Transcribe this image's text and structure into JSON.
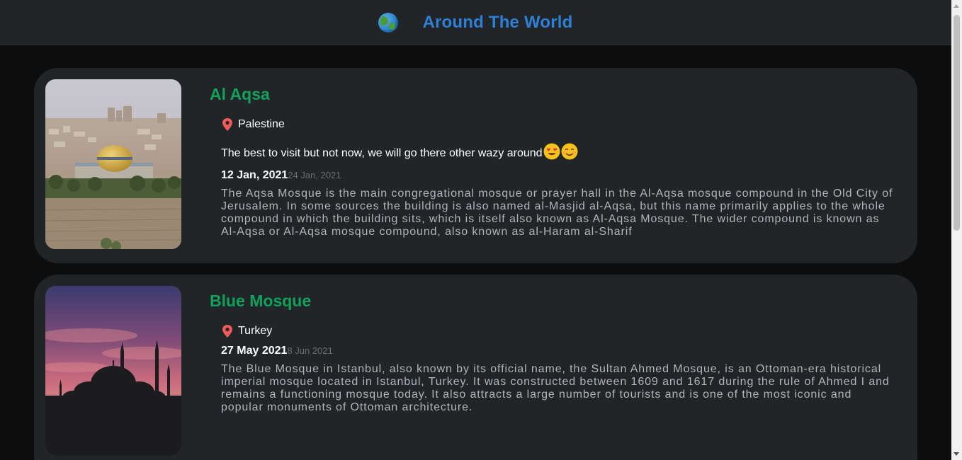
{
  "header": {
    "title": "Around The World",
    "icon": "globe-icon"
  },
  "cards": [
    {
      "title": "Al Aqsa",
      "location": "Palestine",
      "tagline": "The best to visit but not now, we will go there other wazy around",
      "date_start": "12 Jan, 2021",
      "date_end": "24 Jan, 2021",
      "description": "The Aqsa Mosque is the main congregational mosque or prayer hall in the Al-Aqsa mosque compound in the Old City of Jerusalem. In some sources the building is also named al-Masjid al-Aqsa, but this name primarily applies to the whole compound in which the building sits, which is itself also known as Al-Aqsa Mosque. The wider compound is known as Al-Aqsa or Al-Aqsa mosque compound, also known as al-Haram al-Sharif"
    },
    {
      "title": "Blue Mosque",
      "location": "Turkey",
      "date_start": "27 May 2021",
      "date_end": "8 Jun 2021",
      "description": "The Blue Mosque in Istanbul, also known by its official name, the Sultan Ahmed Mosque, is an Ottoman-era historical imperial mosque located in Istanbul, Turkey. It was constructed between 1609 and 1617 during the rule of Ahmed I and remains a functioning mosque today. It also attracts a large number of tourists and is one of the most iconic and popular monuments of Ottoman architecture."
    }
  ],
  "colors": {
    "page_bg": "#0d0d0d",
    "card_bg": "#222527",
    "title_accent": "#2e7fd6",
    "card_title": "#11a15c",
    "pin": "#ef5b5b"
  }
}
